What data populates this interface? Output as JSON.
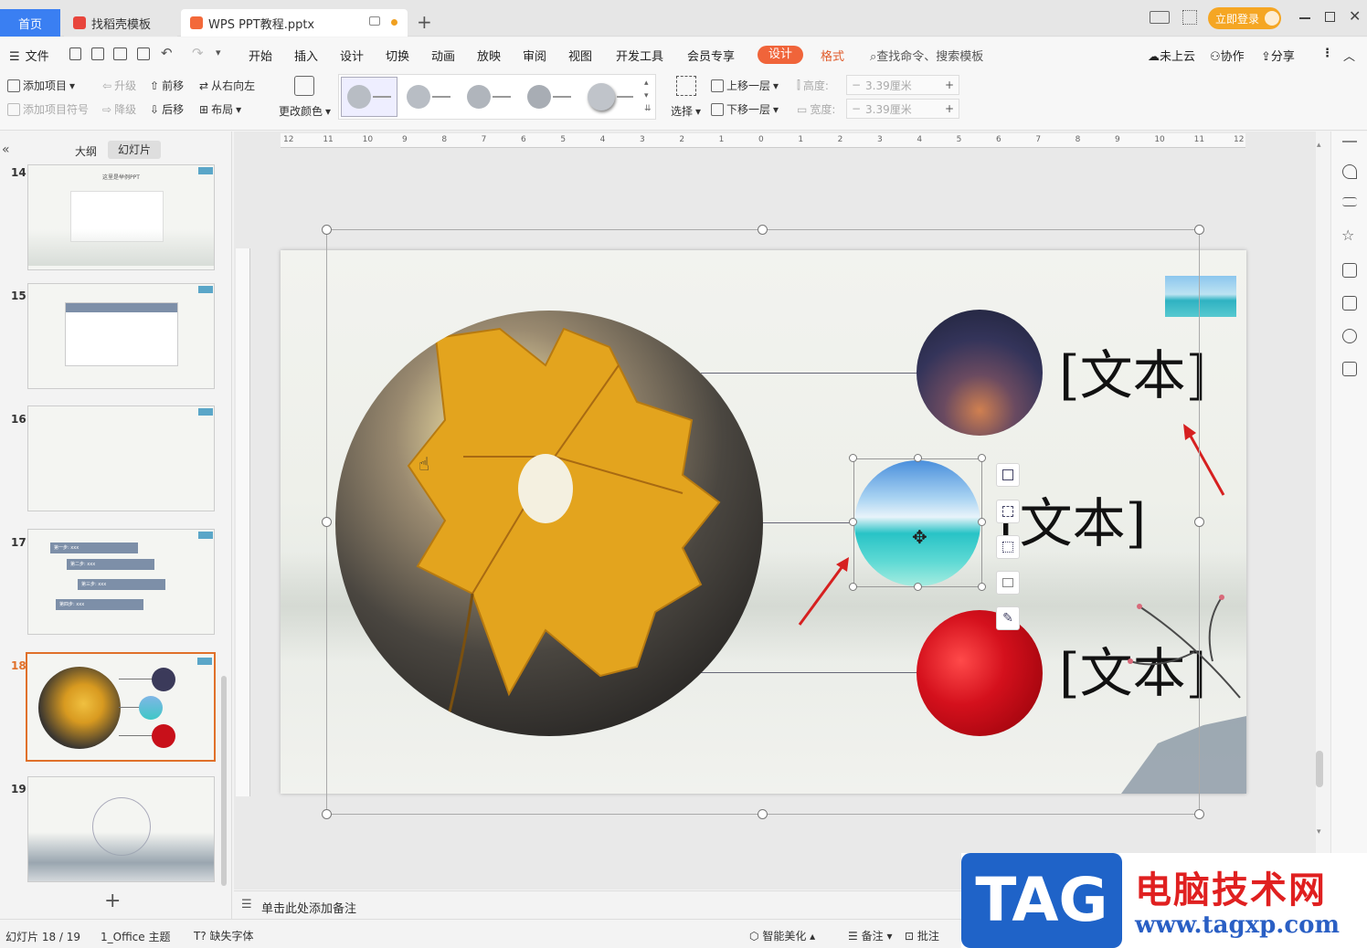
{
  "tabs": {
    "home": "首页",
    "template": "找稻壳模板",
    "document": "WPS PPT教程.pptx"
  },
  "titlebar": {
    "login": "立即登录"
  },
  "menu": {
    "file": "文件",
    "items": [
      "开始",
      "插入",
      "设计",
      "切换",
      "动画",
      "放映",
      "审阅",
      "视图",
      "开发工具",
      "会员专享"
    ],
    "active_design": "设计",
    "format": "格式",
    "search_placeholder": "查找命令、搜索模板",
    "cloud": "未上云",
    "collab": "协作",
    "share": "分享"
  },
  "ribbon": {
    "add_item": "添加项目",
    "add_bullet": "添加项目符号",
    "upgrade": "升级",
    "downgrade": "降级",
    "move_forward": "前移",
    "move_backward": "后移",
    "right_to_left": "从右向左",
    "layout": "布局",
    "change_color": "更改颜色",
    "select": "选择",
    "bring_forward": "上移一层",
    "send_backward": "下移一层",
    "height_label": "高度:",
    "height_value": "3.39厘米",
    "width_label": "宽度:",
    "width_value": "3.39厘米"
  },
  "leftpanel": {
    "outline_tab": "大纲",
    "slides_tab": "幻灯片",
    "slides": [
      {
        "num": "14",
        "title": "这里是举例PPT"
      },
      {
        "num": "15",
        "title": ""
      },
      {
        "num": "16",
        "title": ""
      },
      {
        "num": "17",
        "title": ""
      },
      {
        "num": "18",
        "title": ""
      },
      {
        "num": "19",
        "title": ""
      }
    ],
    "slide17_rows": [
      "第一步: xxx",
      "第二步: xxx",
      "第三步: xxx",
      "第四步: xxx"
    ]
  },
  "ruler": {
    "ticks": [
      "12",
      "11",
      "10",
      "9",
      "8",
      "7",
      "6",
      "5",
      "4",
      "3",
      "2",
      "1",
      "0",
      "1",
      "2",
      "3",
      "4",
      "5",
      "6",
      "7",
      "8",
      "9",
      "10",
      "11",
      "12"
    ]
  },
  "slide": {
    "text1": "[文本]",
    "text2": "[文本]",
    "text3": "[文本]"
  },
  "notes": {
    "placeholder": "单击此处添加备注"
  },
  "status": {
    "slide_count": "幻灯片 18 / 19",
    "theme": "1_Office 主题",
    "missing_font": "缺失字体",
    "smart_beautify": "智能美化",
    "notes": "备注",
    "comments": "批注"
  },
  "watermark": {
    "tag": "TAG",
    "site_cn": "电脑技术网",
    "url": "www.tagxp.com"
  },
  "colors": {
    "accent_blue": "#3a7ff2",
    "design_tab": "#f0643a",
    "format_tab": "#e05a2a",
    "selected_thumb": "#e0702a"
  }
}
